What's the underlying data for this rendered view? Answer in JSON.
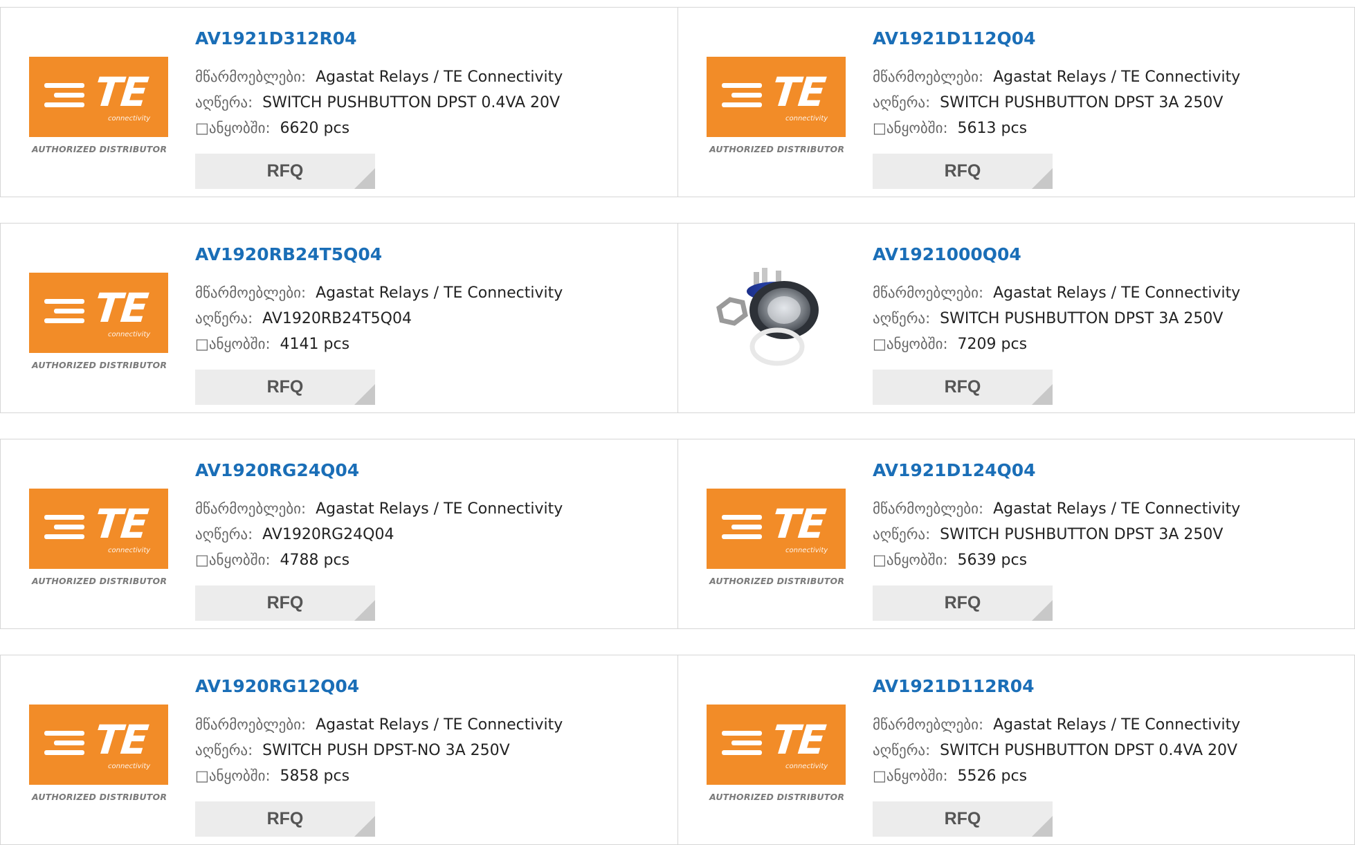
{
  "labels": {
    "manufacturer": "მწარმოებლები:",
    "description": "აღწერა:",
    "stock": "□ანყობში:",
    "rfq": "RFQ"
  },
  "logo": {
    "brand": "TE",
    "sub": "connectivity",
    "authorized": "AUTHORIZED DISTRIBUTOR",
    "color": "#f28c28"
  },
  "products": [
    {
      "part": "AV1921D312R04",
      "manufacturer": "Agastat Relays / TE Connectivity",
      "description": "SWITCH PUSHBUTTON DPST 0.4VA 20V",
      "stock": "6620 pcs",
      "image": "te-logo"
    },
    {
      "part": "AV1921D112Q04",
      "manufacturer": "Agastat Relays / TE Connectivity",
      "description": "SWITCH PUSHBUTTON DPST 3A 250V",
      "stock": "5613 pcs",
      "image": "te-logo"
    },
    {
      "part": "AV1920RB24T5Q04",
      "manufacturer": "Agastat Relays / TE Connectivity",
      "description": "AV1920RB24T5Q04",
      "stock": "4141 pcs",
      "image": "te-logo"
    },
    {
      "part": "AV1921000Q04",
      "manufacturer": "Agastat Relays / TE Connectivity",
      "description": "SWITCH PUSHBUTTON DPST 3A 250V",
      "stock": "7209 pcs",
      "image": "pushbutton-photo"
    },
    {
      "part": "AV1920RG24Q04",
      "manufacturer": "Agastat Relays / TE Connectivity",
      "description": "AV1920RG24Q04",
      "stock": "4788 pcs",
      "image": "te-logo"
    },
    {
      "part": "AV1921D124Q04",
      "manufacturer": "Agastat Relays / TE Connectivity",
      "description": "SWITCH PUSHBUTTON DPST 3A 250V",
      "stock": "5639 pcs",
      "image": "te-logo"
    },
    {
      "part": "AV1920RG12Q04",
      "manufacturer": "Agastat Relays / TE Connectivity",
      "description": "SWITCH PUSH DPST-NO 3A 250V",
      "stock": "5858 pcs",
      "image": "te-logo"
    },
    {
      "part": "AV1921D112R04",
      "manufacturer": "Agastat Relays / TE Connectivity",
      "description": "SWITCH PUSHBUTTON DPST 0.4VA 20V",
      "stock": "5526 pcs",
      "image": "te-logo"
    }
  ]
}
